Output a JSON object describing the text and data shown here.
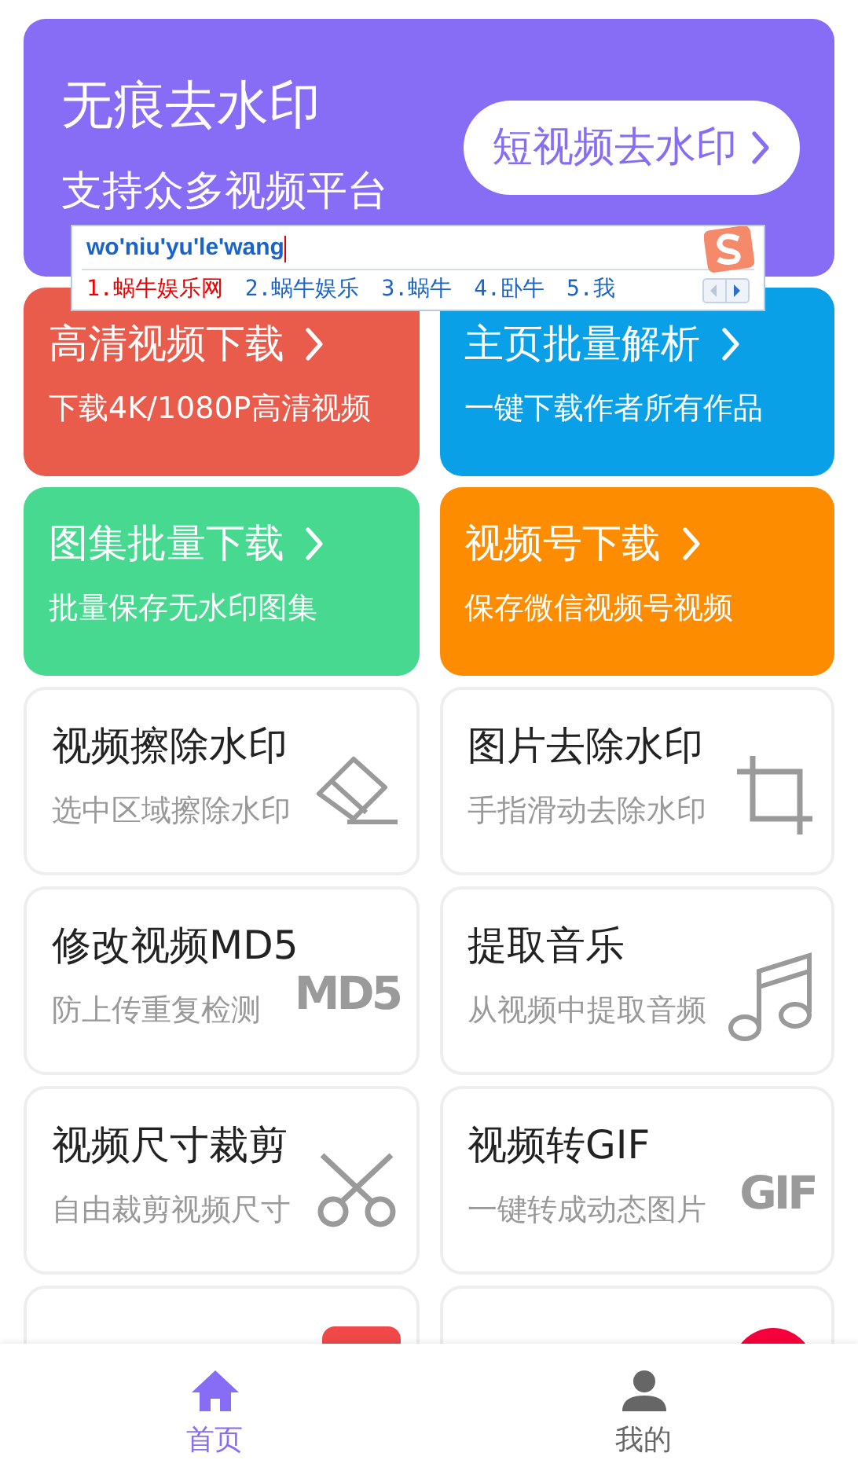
{
  "hero": {
    "title": "无痕去水印",
    "subtitle": "支持众多视频平台",
    "button": "短视频去水印"
  },
  "tools": [
    {
      "kind": "color",
      "title": "高清视频下载",
      "subtitle": "下载4K/1080P高清视频",
      "color": "#e95b4b"
    },
    {
      "kind": "color",
      "title": "主页批量解析",
      "subtitle": "一键下载作者所有作品",
      "color": "#0aa0e8"
    },
    {
      "kind": "color",
      "title": "图集批量下载",
      "subtitle": "批量保存无水印图集",
      "color": "#47d98f"
    },
    {
      "kind": "color",
      "title": "视频号下载",
      "subtitle": "保存微信视频号视频",
      "color": "#fd8c00"
    },
    {
      "kind": "plain",
      "title": "视频擦除水印",
      "subtitle": "选中区域擦除水印"
    },
    {
      "kind": "plain",
      "title": "图片去除水印",
      "subtitle": "手指滑动去除水印"
    },
    {
      "kind": "plain",
      "title": "修改视频MD5",
      "subtitle": "防上传重复检测",
      "icon_text": "MD5"
    },
    {
      "kind": "plain",
      "title": "提取音乐",
      "subtitle": "从视频中提取音频"
    },
    {
      "kind": "plain",
      "title": "视频尺寸裁剪",
      "subtitle": "自由裁剪视频尺寸"
    },
    {
      "kind": "plain",
      "title": "视频转GIF",
      "subtitle": "一键转成动态图片",
      "icon_text": "GIF"
    },
    {
      "kind": "plain"
    },
    {
      "kind": "plain"
    }
  ],
  "ime": {
    "input": "wo'niu'yu'le'wang",
    "candidates": [
      {
        "label": "1.蜗牛娱乐网",
        "selected": true
      },
      {
        "label": "2.蜗牛娱乐",
        "selected": false
      },
      {
        "label": "3.蜗牛",
        "selected": false
      },
      {
        "label": "4.卧牛",
        "selected": false
      },
      {
        "label": "5.我",
        "selected": false
      }
    ]
  },
  "nav": [
    {
      "label": "首页",
      "selected": true
    },
    {
      "label": "我的",
      "selected": false
    }
  ]
}
